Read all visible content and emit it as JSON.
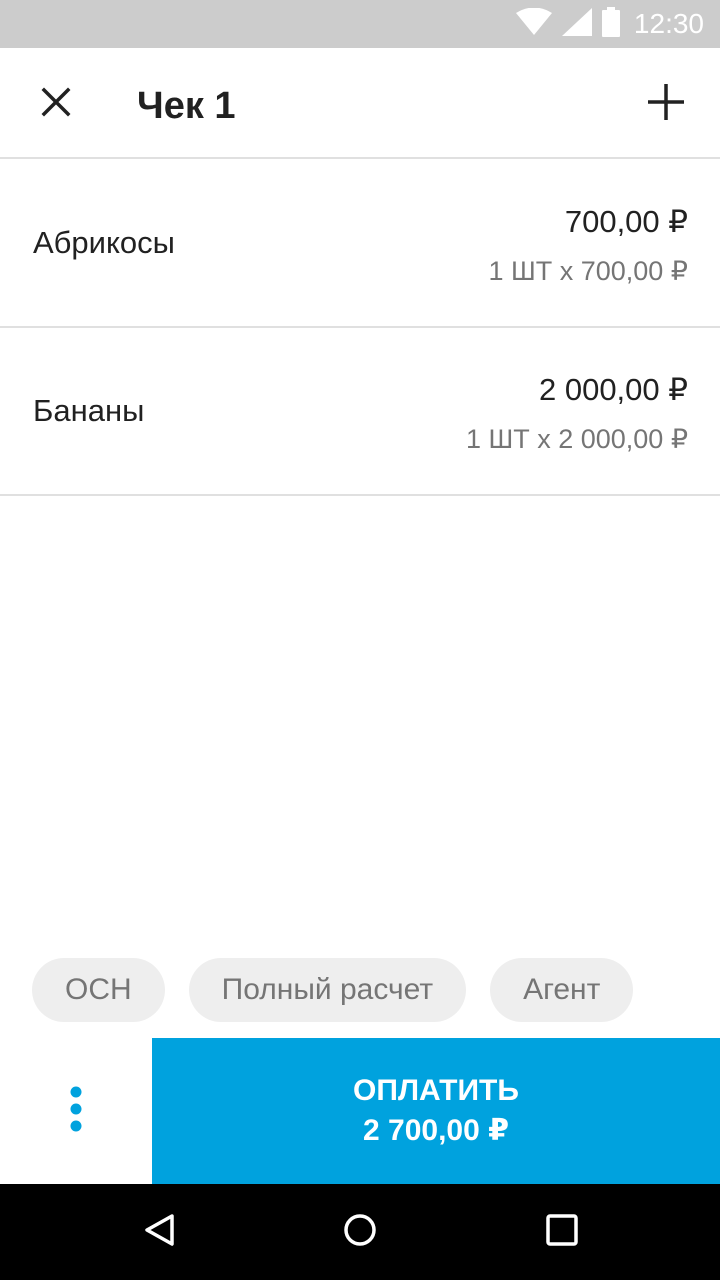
{
  "status_bar": {
    "time": "12:30",
    "icons": [
      "wifi-icon",
      "signal-icon",
      "battery-icon"
    ]
  },
  "header": {
    "title": "Чек 1",
    "close_icon": "close-icon",
    "add_icon": "plus-icon"
  },
  "items": [
    {
      "name": "Абрикосы",
      "total": "700,00 ₽",
      "detail": "1 ШТ x 700,00 ₽"
    },
    {
      "name": "Бананы",
      "total": "2 000,00 ₽",
      "detail": "1 ШТ x 2 000,00 ₽"
    }
  ],
  "chips": [
    "ОСН",
    "Полный расчет",
    "Агент"
  ],
  "pay_button": {
    "label": "ОПЛАТИТЬ",
    "amount": "2 700,00 ₽"
  },
  "colors": {
    "accent": "#00a2de",
    "status_bar": "#cccccc",
    "chip_bg": "#eeeeee"
  },
  "nav_icons": [
    "back-icon",
    "home-icon",
    "recents-icon"
  ]
}
